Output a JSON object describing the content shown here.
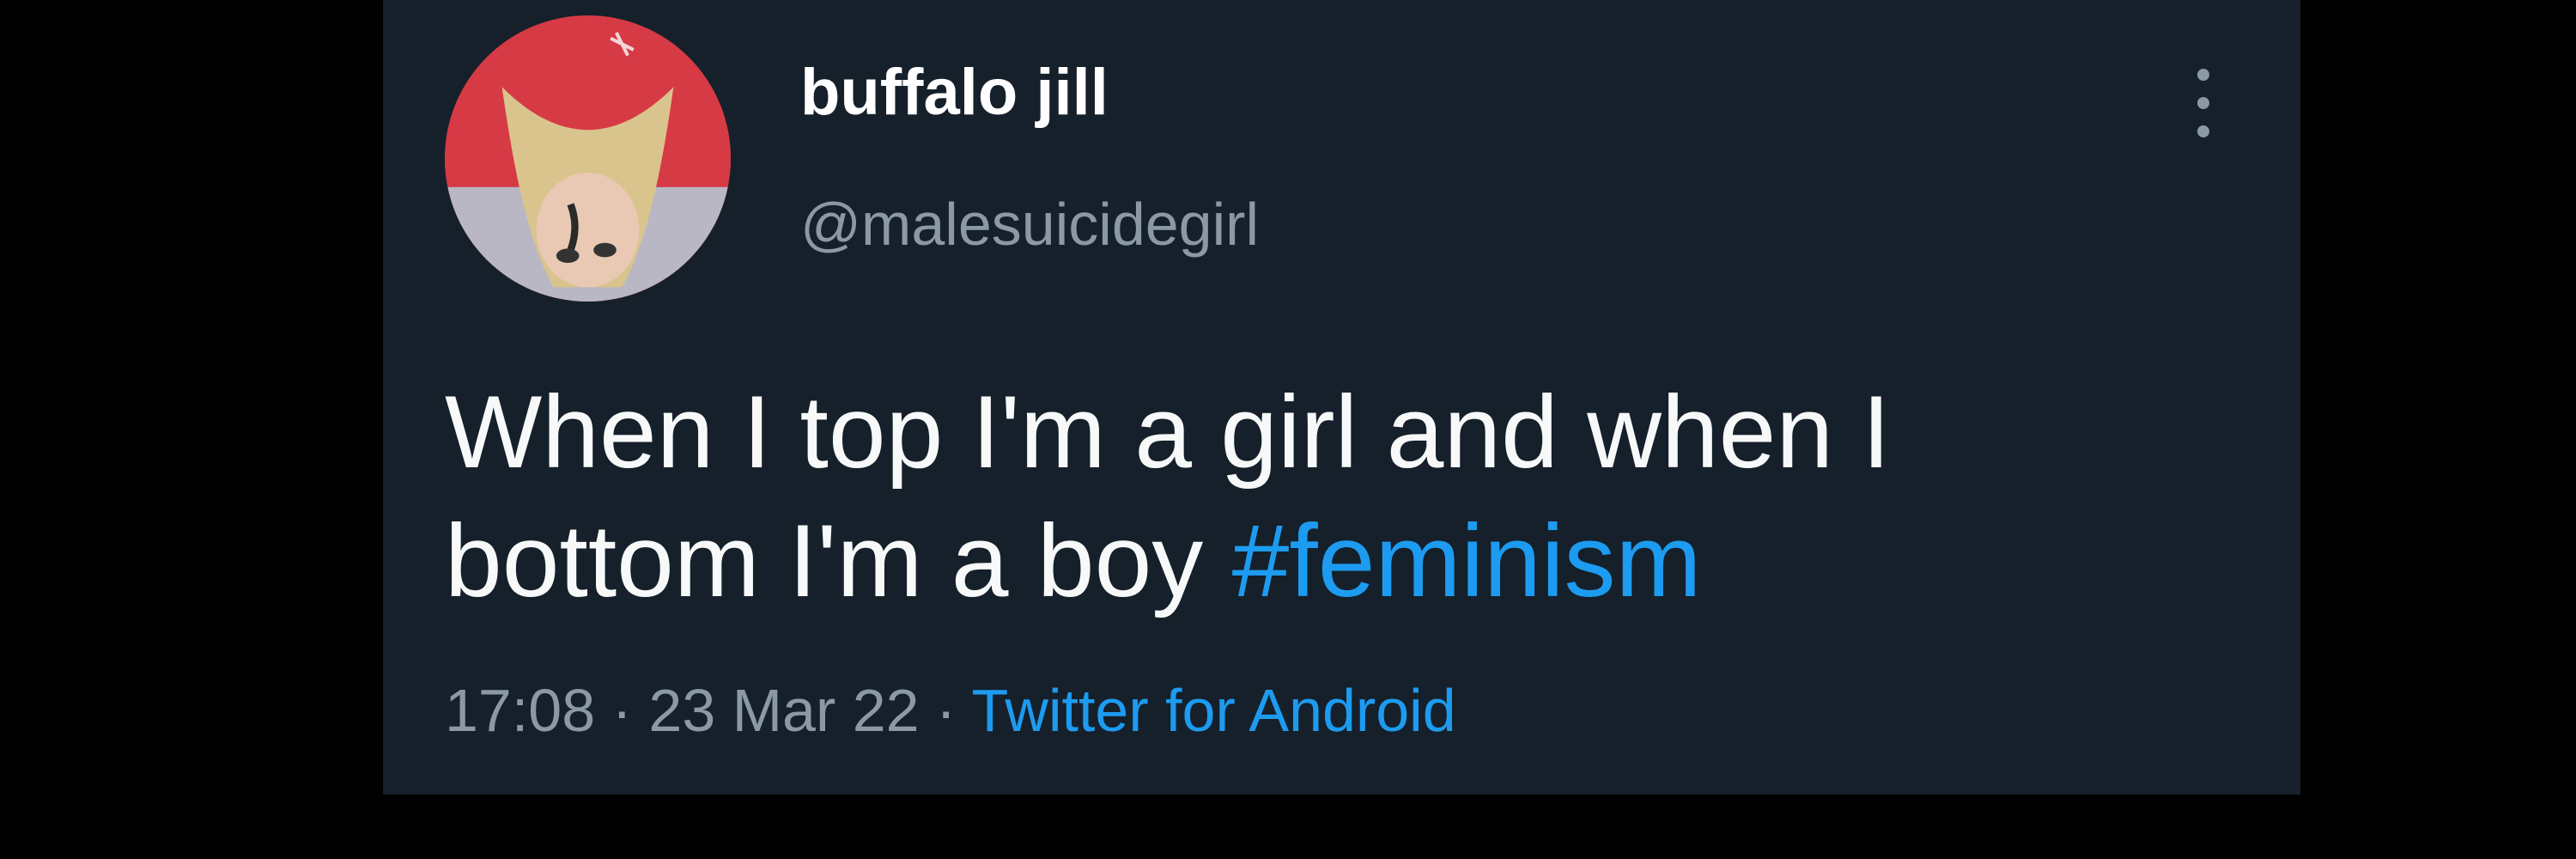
{
  "tweet": {
    "author": {
      "display_name": "buffalo jill",
      "handle": "@malesuicidegirl",
      "avatar_icon": "profile-photo"
    },
    "more_icon": "three-dots-vertical-icon",
    "text_parts": {
      "line1": "When I top I'm a girl and when I",
      "line2_prefix": "bottom I'm a boy ",
      "hashtag": "#feminism"
    },
    "meta": {
      "time": "17:08",
      "separator1": " · ",
      "date": "23 Mar 22",
      "separator2": " · ",
      "source": "Twitter for Android"
    }
  },
  "colors": {
    "background": "#000000",
    "card": "#15202b",
    "text_primary": "#f7f9f9",
    "text_secondary": "#8b98a5",
    "accent": "#1d9bf0"
  }
}
